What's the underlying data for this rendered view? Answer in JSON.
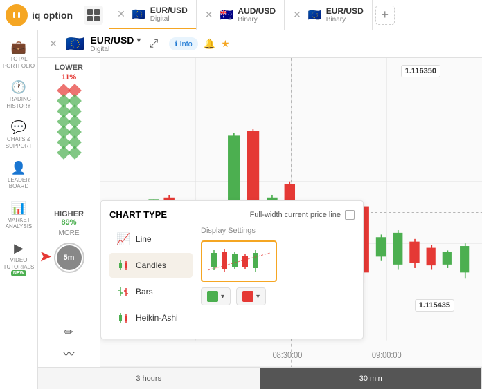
{
  "logo": {
    "icon": "IQ",
    "text": "iq option"
  },
  "tabs": [
    {
      "id": "tab1",
      "pair": "EUR/USD",
      "type": "Digital",
      "flag": "🇪🇺",
      "active": true,
      "closeable": true
    },
    {
      "id": "tab2",
      "pair": "AUD/USD",
      "type": "Binary",
      "flag": "🇦🇺",
      "active": false,
      "closeable": true
    },
    {
      "id": "tab3",
      "pair": "EUR/USD",
      "type": "Binary",
      "flag": "🇪🇺",
      "active": false,
      "closeable": true
    }
  ],
  "sidebar": {
    "items": [
      {
        "id": "portfolio",
        "icon": "💼",
        "label": "TOTAL\nPORTFOLIO"
      },
      {
        "id": "history",
        "icon": "🕐",
        "label": "TRADING\nHISTORY"
      },
      {
        "id": "chats",
        "icon": "💬",
        "label": "CHATS &\nSUPPORT"
      },
      {
        "id": "leaderboard",
        "icon": "👤",
        "label": "LEADER\nBOARD"
      },
      {
        "id": "market",
        "icon": "📊",
        "label": "MARKET\nANALYSIS"
      },
      {
        "id": "tutorials",
        "icon": "▶",
        "label": "VIDEO\nTUTORIALS"
      }
    ]
  },
  "asset": {
    "pair": "EUR/USD",
    "type": "Digital",
    "flag": "🇪🇺"
  },
  "trade": {
    "lower_label": "LOWER",
    "lower_pct": "11%",
    "higher_label": "HIGHER",
    "higher_pct": "89%",
    "more_label": "MORE",
    "time_label": "5m"
  },
  "chart": {
    "price_high": "1.116350",
    "price_low": "1.115435",
    "time_labels": [
      "08:30:00",
      "09:00:00"
    ]
  },
  "chart_type": {
    "title": "CHART TYPE",
    "full_width_label": "Full-width current price line",
    "types": [
      {
        "id": "line",
        "label": "Line",
        "icon": "📈"
      },
      {
        "id": "candles",
        "label": "Candles",
        "icon": "🕯",
        "selected": true
      },
      {
        "id": "bars",
        "label": "Bars",
        "icon": "📊"
      },
      {
        "id": "heikin",
        "label": "Heikin-Ashi",
        "icon": "🕯"
      }
    ],
    "display_settings_title": "Display Settings",
    "color_up": "#4caf50",
    "color_down": "#e53935"
  },
  "bottom_controls": {
    "options": [
      {
        "id": "3h",
        "label": "3 hours"
      },
      {
        "id": "30m",
        "label": "30 min",
        "active": true
      }
    ]
  },
  "tools": {
    "pencil": "✏",
    "wave": "〰"
  }
}
